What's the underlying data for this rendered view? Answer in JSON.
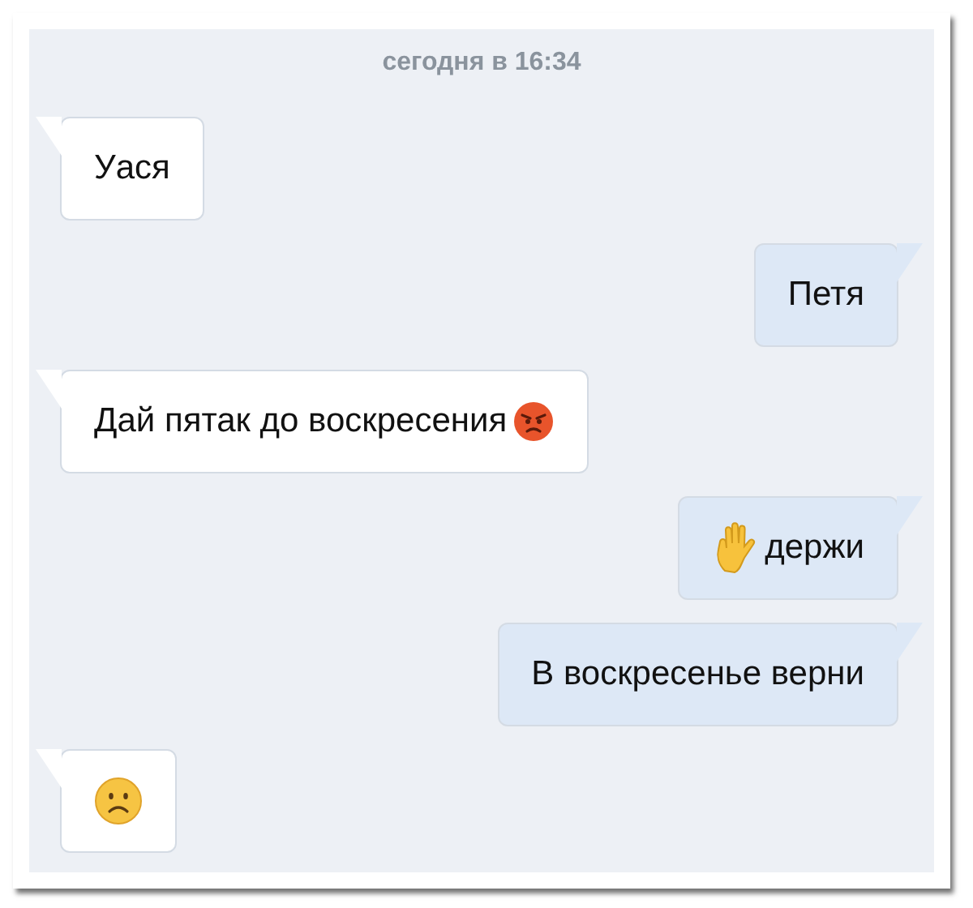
{
  "chat": {
    "date_divider": "сегодня в 16:34",
    "messages": [
      {
        "outgoing": false,
        "kind": "text",
        "text": "Уася"
      },
      {
        "outgoing": true,
        "kind": "text",
        "text": "Петя"
      },
      {
        "outgoing": false,
        "kind": "angry",
        "text": "Дай пятак до воскресения"
      },
      {
        "outgoing": true,
        "kind": "hand",
        "text": "держи"
      },
      {
        "outgoing": true,
        "kind": "text",
        "text": "В воскресенье верни"
      },
      {
        "outgoing": false,
        "kind": "frown"
      }
    ]
  }
}
